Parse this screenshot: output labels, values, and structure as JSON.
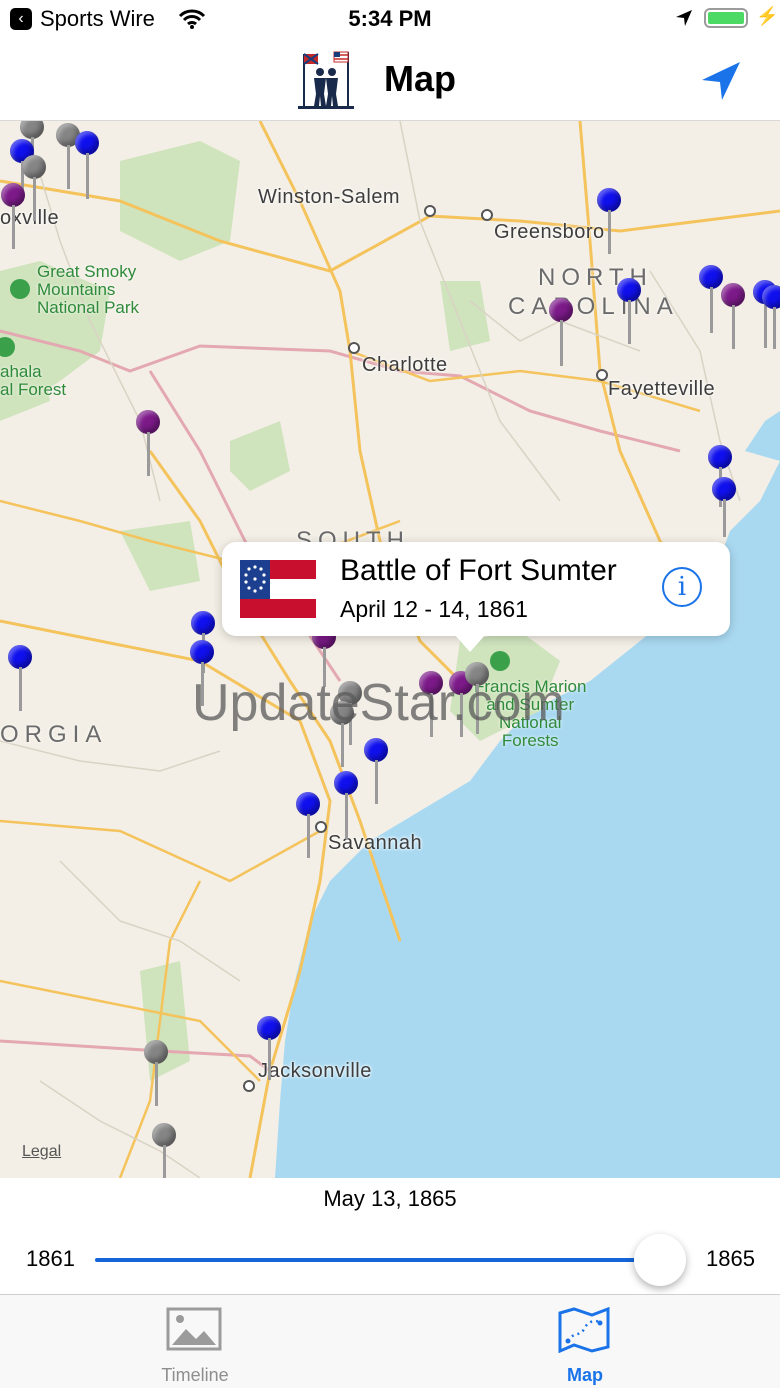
{
  "status_bar": {
    "back_app": "Sports Wire",
    "time": "5:34 PM"
  },
  "nav": {
    "title": "Map",
    "logo_icon": "soldiers-flags-logo-icon",
    "locate_icon": "location-arrow-icon"
  },
  "map": {
    "cities": [
      "Winston-Salem",
      "Greensboro",
      "Charlotte",
      "Fayetteville",
      "Savannah",
      "Jacksonville",
      "oxville"
    ],
    "states": [
      "NORTH",
      "CAROLINA",
      "SOUTH",
      "ORGIA"
    ],
    "parks": {
      "smoky": "Great Smoky\nMountains\nNational Park",
      "nantahala": "ahala\nal Forest",
      "francis_marion": "Francis Marion\nand Sumter\nNational\nForests"
    },
    "legal": "Legal",
    "watermark": "UpdateStar.com",
    "pin_colors": {
      "union": "#1010ee",
      "confederate": "#7d1a8a",
      "neutral": "#858585"
    }
  },
  "callout": {
    "title": "Battle of Fort Sumter",
    "date": "April 12 - 14, 1861",
    "flag_icon": "confederate-first-national-flag-icon",
    "info_icon": "info-icon"
  },
  "timeline_slider": {
    "current_date": "May 13, 1865",
    "start_year": "1861",
    "end_year": "1865",
    "position": 1.0
  },
  "tabs": [
    {
      "label": "Timeline",
      "icon": "image-icon",
      "active": false
    },
    {
      "label": "Map",
      "icon": "map-route-icon",
      "active": true
    }
  ],
  "colors": {
    "accent": "#1565d8",
    "water": "#a9d9f1",
    "land": "#f3efe6",
    "park": "#cfe3bd"
  }
}
